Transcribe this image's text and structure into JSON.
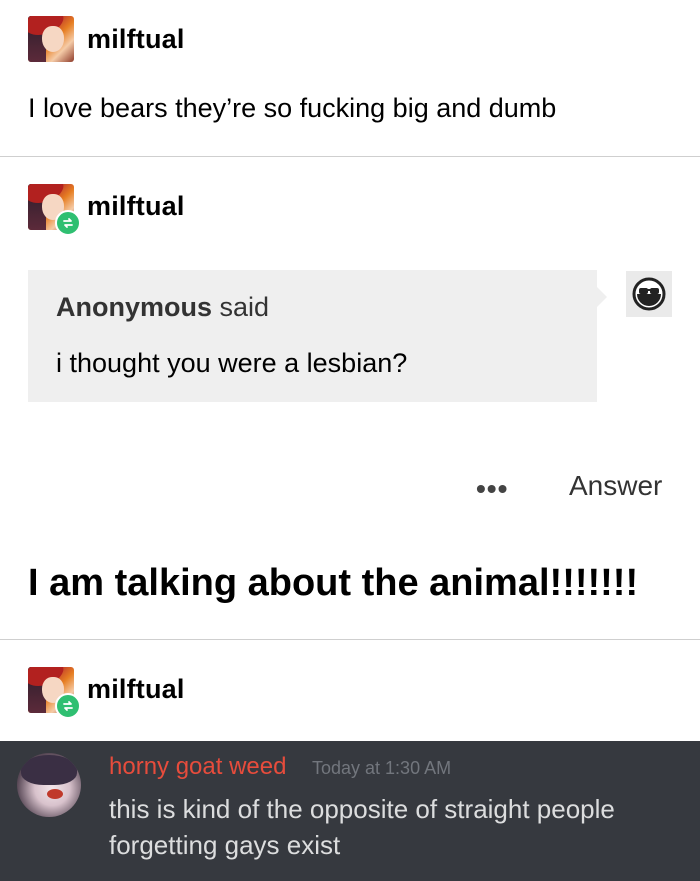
{
  "posts": [
    {
      "username": "milftual",
      "text": "I love bears they’re so fucking big and dumb"
    },
    {
      "username": "milftual",
      "ask": {
        "asker": "Anonymous",
        "said": "said",
        "question": "i thought you were a lesbian?"
      },
      "actions": {
        "more": "•••",
        "answer": "Answer"
      },
      "reply": "I am talking about the animal!!!!!!!"
    },
    {
      "username": "milftual"
    }
  ],
  "discord": {
    "username": "horny goat weed",
    "timestamp": "Today at 1:30 AM",
    "message": "this is kind of the opposite of straight people forgetting gays exist",
    "colors": {
      "background": "#36393f",
      "username": "#e74c3c",
      "text": "#dcddde",
      "timestamp": "#72767d"
    }
  },
  "icons": {
    "reblog": "reblog-icon",
    "anon": "anonymous-sunglasses-icon"
  }
}
